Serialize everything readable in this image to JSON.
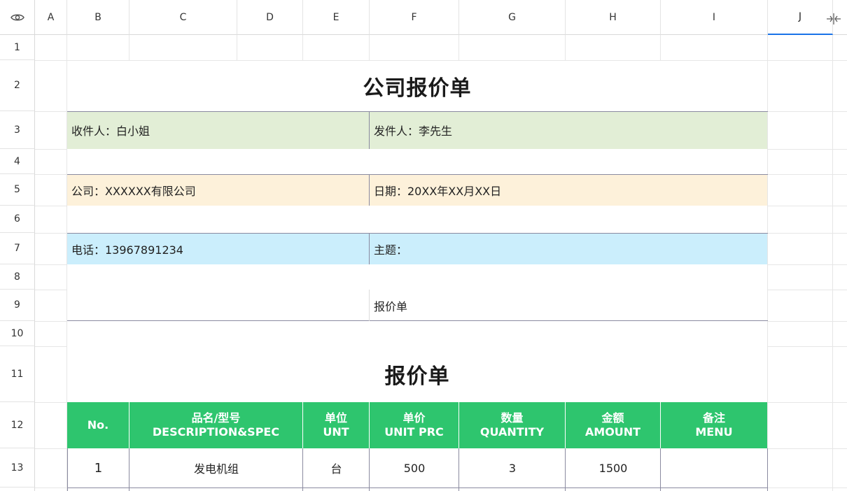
{
  "columns": [
    "A",
    "B",
    "C",
    "D",
    "E",
    "F",
    "G",
    "H",
    "I",
    "J"
  ],
  "rows": [
    "1",
    "2",
    "3",
    "4",
    "5",
    "6",
    "7",
    "8",
    "9",
    "10",
    "11",
    "12",
    "13"
  ],
  "colors": {
    "green_band": "#e2eed6",
    "yellow_band": "#fdf1da",
    "blue_band": "#cbeefc",
    "table_header": "#2ec56e"
  },
  "sheet": {
    "title": "公司报价单",
    "recipient": "收件人：白小姐",
    "sender": "发件人：李先生",
    "company": "公司：XXXXXX有限公司",
    "date": "日期：20XX年XX月XX日",
    "phone": "电话：13967891234",
    "subject": "主题：",
    "row9_text": "报价单",
    "subtitle": "报价单"
  },
  "table": {
    "headers": [
      {
        "cn": "No.",
        "en": ""
      },
      {
        "cn": "品名/型号",
        "en": "DESCRIPTION&SPEC"
      },
      {
        "cn": "单位",
        "en": "UNT"
      },
      {
        "cn": "单价",
        "en": "UNIT PRC"
      },
      {
        "cn": "数量",
        "en": "QUANTITY"
      },
      {
        "cn": "金额",
        "en": "AMOUNT"
      },
      {
        "cn": "备注",
        "en": "MENU"
      }
    ],
    "rows": [
      [
        "1",
        "发电机组",
        "台",
        "500",
        "3",
        "1500",
        ""
      ]
    ]
  }
}
